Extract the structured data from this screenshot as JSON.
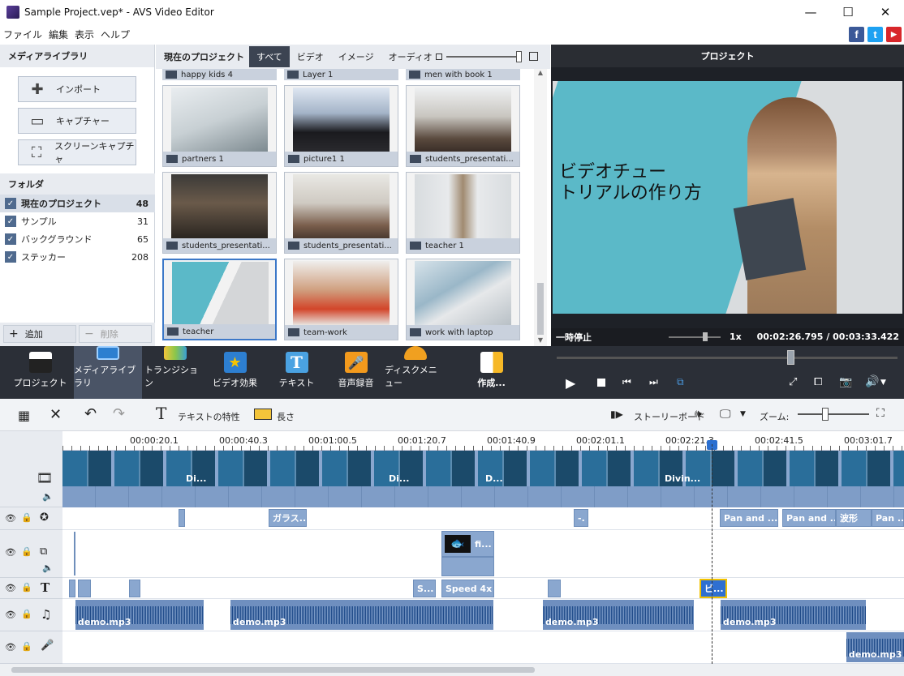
{
  "window": {
    "title": "Sample Project.vep* - AVS Video Editor",
    "minimize": "—",
    "maximize": "☐",
    "close": "✕"
  },
  "menu": [
    "ファイル",
    "編集",
    "表示",
    "ヘルプ"
  ],
  "social": {
    "facebook": "f",
    "twitter": "t",
    "youtube": "▶"
  },
  "media_panel": {
    "title": "メディアライブラリ",
    "import_label": "インポート",
    "capture_label": "キャプチャー",
    "screen_capture_label": "スクリーンキャプチャ",
    "folders_title": "フォルダ",
    "folders": [
      {
        "label": "現在のプロジェクト",
        "count": "48"
      },
      {
        "label": "サンプル",
        "count": "31"
      },
      {
        "label": "バックグラウンド",
        "count": "65"
      },
      {
        "label": "ステッカー",
        "count": "208"
      }
    ],
    "add_label": "追加",
    "delete_label": "削除"
  },
  "library": {
    "title": "現在のプロジェクト",
    "tabs": [
      "すべて",
      "ビデオ",
      "イメージ",
      "オーディオ"
    ],
    "active_tab": "すべて",
    "top_captions": [
      "happy kids 4",
      "Layer 1",
      "men with book 1"
    ],
    "items": [
      "partners 1",
      "picture1 1",
      "students_presentati...",
      "students_presentati...",
      "students_presentati...",
      "teacher 1",
      "teacher",
      "team-work",
      "work with laptop"
    ]
  },
  "preview": {
    "title": "プロジェクト",
    "overlay_text_line1": "ビデオチュー",
    "overlay_text_line2": "トリアルの作り方",
    "status": "一時停止",
    "speed": "1x",
    "time": "00:02:26.795 / 00:03:33.422",
    "accent": "#5bb9c8"
  },
  "main_toolbar": [
    {
      "label": "プロジェクト",
      "icon": "clapper-icon"
    },
    {
      "label": "メディアライブラリ",
      "icon": "film-library-icon"
    },
    {
      "label": "トランジション",
      "icon": "transition-icon"
    },
    {
      "label": "ビデオ効果",
      "icon": "star-effect-icon"
    },
    {
      "label": "テキスト",
      "icon": "text-icon"
    },
    {
      "label": "音声録音",
      "icon": "microphone-icon"
    },
    {
      "label": "ディスクメニュー",
      "icon": "disc-menu-icon"
    },
    {
      "label": "作成...",
      "icon": "produce-icon"
    }
  ],
  "edit_toolbar": {
    "text_props": "テキストの特性",
    "duration": "長さ",
    "storyboard": "ストーリーボード",
    "zoom_label": "ズーム:"
  },
  "ruler": [
    "00:00:20.1",
    "00:00:40.3",
    "00:01:00.5",
    "00:01:20.7",
    "00:01:40.9",
    "00:02:01.1",
    "00:02:21.3",
    "00:02:41.5",
    "00:03:01.7"
  ],
  "timeline": {
    "video_clip_labels": [
      "Di...",
      "Di...",
      "D...",
      "Divin..."
    ],
    "effect_clips": [
      "ガラス...",
      "-.",
      "Pan and ...",
      "Pan and ...",
      "波形",
      "Pan ..."
    ],
    "overlay_clip": "fi...",
    "text_clips": [
      "S...",
      "Speed 4x",
      "ビ..."
    ],
    "audio_clips": [
      "demo.mp3",
      "demo.mp3",
      "demo.mp3",
      "demo.mp3",
      "demo.mp3"
    ]
  }
}
